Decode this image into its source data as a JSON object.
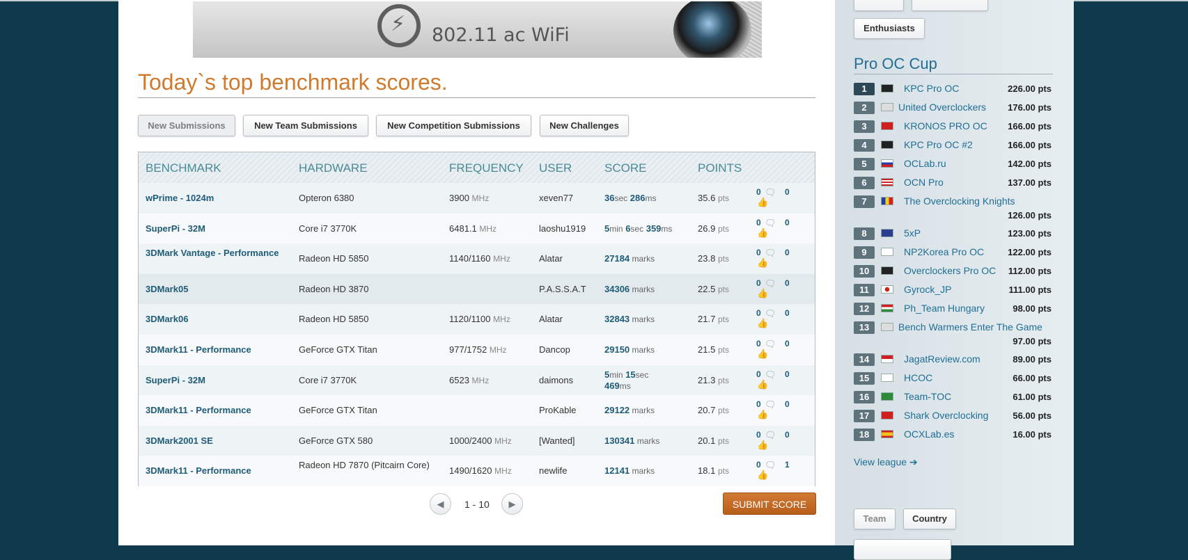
{
  "banner": {
    "text": "802.11 ac WiFi"
  },
  "title": "Today`s top benchmark scores.",
  "tabs": [
    {
      "label": "New Submissions",
      "active": true
    },
    {
      "label": "New Team Submissions"
    },
    {
      "label": "New Competition Submissions"
    },
    {
      "label": "New Challenges"
    }
  ],
  "table": {
    "headers": [
      "BENCHMARK",
      "HARDWARE",
      "FREQUENCY",
      "USER",
      "SCORE",
      "POINTS"
    ],
    "rows": [
      {
        "benchmark": "wPrime - 1024m",
        "hardware": "Opteron 6380",
        "freq": "3900",
        "freq_unit": "MHz",
        "user": "xeven77",
        "score": [
          [
            "36",
            "sec"
          ],
          [
            " 286",
            "ms"
          ]
        ],
        "points": "35.6",
        "pts_unit": "pts",
        "votes_a": "0",
        "votes_b": "0"
      },
      {
        "benchmark": "SuperPi - 32M",
        "hardware": "Core i7 3770K",
        "freq": "6481.1",
        "freq_unit": "MHz",
        "user": "laoshu1919",
        "score": [
          [
            "5",
            "min"
          ],
          [
            " 6",
            "sec"
          ],
          [
            " 359",
            "ms"
          ]
        ],
        "points": "26.9",
        "pts_unit": "pts",
        "votes_a": "0",
        "votes_b": "0"
      },
      {
        "benchmark": "3DMark Vantage - Performance",
        "hardware": "Radeon HD 5850",
        "freq": "1140/1160",
        "freq_unit": "MHz",
        "user": "Alatar",
        "score": [
          [
            "27184",
            " marks"
          ]
        ],
        "points": "23.8",
        "pts_unit": "pts",
        "votes_a": "0",
        "votes_b": "0"
      },
      {
        "benchmark": "3DMark05",
        "hardware": "Radeon HD 3870",
        "freq": "",
        "freq_unit": "",
        "user": "P.A.S.S.A.T",
        "score": [
          [
            "34306",
            " marks"
          ]
        ],
        "points": "22.5",
        "pts_unit": "pts",
        "votes_a": "0",
        "votes_b": "0"
      },
      {
        "benchmark": "3DMark06",
        "hardware": "Radeon HD 5850",
        "freq": "1120/1100",
        "freq_unit": "MHz",
        "user": "Alatar",
        "score": [
          [
            "32843",
            " marks"
          ]
        ],
        "points": "21.7",
        "pts_unit": "pts",
        "votes_a": "0",
        "votes_b": "0"
      },
      {
        "benchmark": "3DMark11 - Performance",
        "hardware": "GeForce GTX Titan",
        "freq": "977/1752",
        "freq_unit": "MHz",
        "user": "Dancop",
        "score": [
          [
            "29150",
            " marks"
          ]
        ],
        "points": "21.5",
        "pts_unit": "pts",
        "votes_a": "0",
        "votes_b": "0"
      },
      {
        "benchmark": "SuperPi - 32M",
        "hardware": "Core i7 3770K",
        "freq": "6523",
        "freq_unit": "MHz",
        "user": "daimons",
        "score": [
          [
            "5",
            "min"
          ],
          [
            " 15",
            "sec"
          ],
          [
            " 469",
            "ms"
          ]
        ],
        "points": "21.3",
        "pts_unit": "pts",
        "votes_a": "0",
        "votes_b": "0"
      },
      {
        "benchmark": "3DMark11 - Performance",
        "hardware": "GeForce GTX Titan",
        "freq": "",
        "freq_unit": "",
        "user": "ProKable",
        "score": [
          [
            "29122",
            " marks"
          ]
        ],
        "points": "20.7",
        "pts_unit": "pts",
        "votes_a": "0",
        "votes_b": "0"
      },
      {
        "benchmark": "3DMark2001 SE",
        "hardware": "GeForce GTX 580",
        "freq": "1000/2400",
        "freq_unit": "MHz",
        "user": "[Wanted]",
        "score": [
          [
            "130341",
            " marks"
          ]
        ],
        "points": "20.1",
        "pts_unit": "pts",
        "votes_a": "0",
        "votes_b": "0"
      },
      {
        "benchmark": "3DMark11 - Performance",
        "hardware": "Radeon HD 7870 (Pitcairn Core)",
        "freq": "1490/1620",
        "freq_unit": "MHz",
        "user": "newlife",
        "score": [
          [
            "12141",
            " marks"
          ]
        ],
        "points": "18.1",
        "pts_unit": "pts",
        "votes_a": "0",
        "votes_b": "1"
      }
    ]
  },
  "pager": {
    "text": "1 - 10"
  },
  "submit_label": "SUBMIT SCORE",
  "sidebar": {
    "enthusiasts_label": "Enthusiasts",
    "cup_title": "Pro OC Cup",
    "teams": [
      {
        "rank": "1",
        "name": "KPC Pro OC",
        "pts": "226.00 pts",
        "flag": "pirate"
      },
      {
        "rank": "2",
        "name": "United Overclockers",
        "pts": "176.00 pts",
        "flag": "unknown"
      },
      {
        "rank": "3",
        "name": "KRONOS PRO OC",
        "pts": "166.00 pts",
        "flag": "albania"
      },
      {
        "rank": "4",
        "name": "KPC Pro OC #2",
        "pts": "166.00 pts",
        "flag": "pirate"
      },
      {
        "rank": "5",
        "name": "OCLab.ru",
        "pts": "142.00 pts",
        "flag": "russia"
      },
      {
        "rank": "6",
        "name": "OCN Pro",
        "pts": "137.00 pts",
        "flag": "usa"
      },
      {
        "rank": "7",
        "name": "The Overclocking Knights",
        "pts": "126.00 pts",
        "flag": "romania"
      },
      {
        "rank": "8",
        "name": "5xP",
        "pts": "123.00 pts",
        "flag": "uk"
      },
      {
        "rank": "9",
        "name": "NP2Korea Pro OC",
        "pts": "122.00 pts",
        "flag": "korea"
      },
      {
        "rank": "10",
        "name": "Overclockers Pro OC",
        "pts": "112.00 pts",
        "flag": "pirate"
      },
      {
        "rank": "11",
        "name": "Gyrock_JP",
        "pts": "111.00 pts",
        "flag": "japan"
      },
      {
        "rank": "12",
        "name": "Ph_Team Hungary",
        "pts": "98.00 pts",
        "flag": "hungary"
      },
      {
        "rank": "13",
        "name": "Bench Warmers Enter The Game",
        "pts": "97.00 pts",
        "flag": "unknown"
      },
      {
        "rank": "14",
        "name": "JagatReview.com",
        "pts": "89.00 pts",
        "flag": "indonesia"
      },
      {
        "rank": "15",
        "name": "HCOC",
        "pts": "66.00 pts",
        "flag": "finland"
      },
      {
        "rank": "16",
        "name": "Team-TOC",
        "pts": "61.00 pts",
        "flag": "southafrica"
      },
      {
        "rank": "17",
        "name": "Shark Overclocking",
        "pts": "56.00 pts",
        "flag": "denmark"
      },
      {
        "rank": "18",
        "name": "OCXLab.es",
        "pts": "16.00 pts",
        "flag": "spain"
      }
    ],
    "view_league": "View league",
    "bottom_tabs": [
      "Team",
      "Country"
    ]
  }
}
